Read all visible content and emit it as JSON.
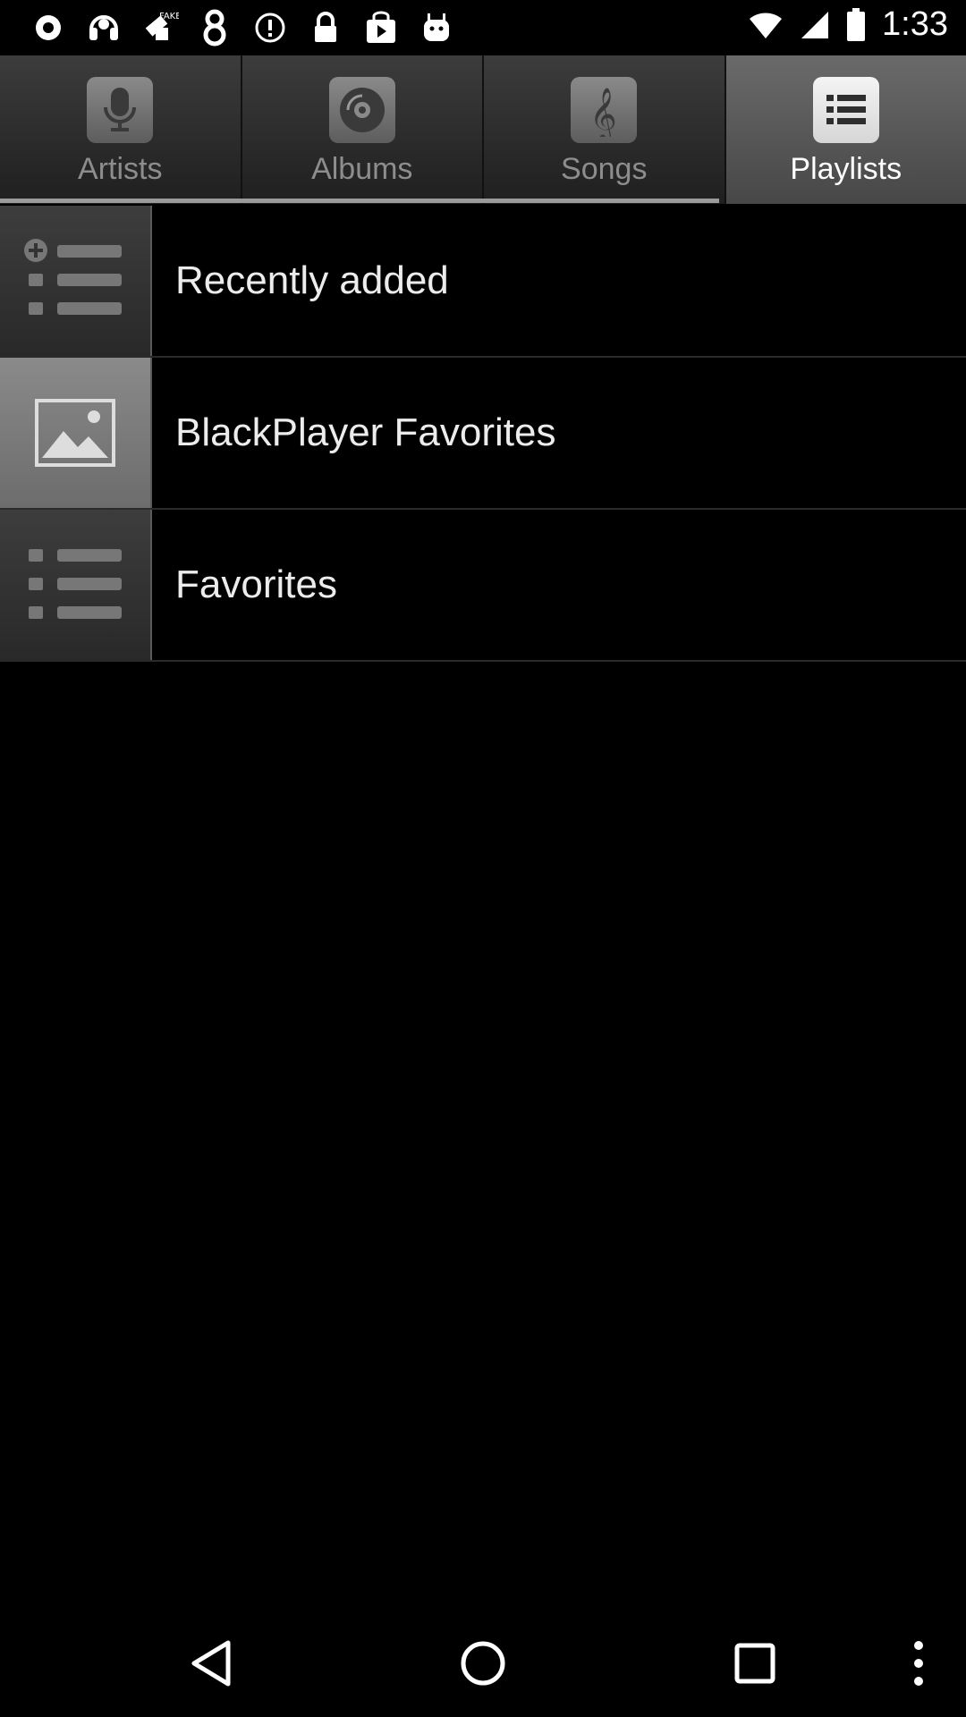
{
  "status_bar": {
    "time": "1:33",
    "icons": [
      "record-icon",
      "headset-icon",
      "fake-gps-icon",
      "eight-icon",
      "info-circle-icon",
      "lock-icon",
      "play-store-icon",
      "android-icon"
    ]
  },
  "tabs": [
    {
      "label": "Artists",
      "icon": "microphone-icon",
      "active": false
    },
    {
      "label": "Albums",
      "icon": "disc-icon",
      "active": false
    },
    {
      "label": "Songs",
      "icon": "treble-clef-icon",
      "active": false
    },
    {
      "label": "Playlists",
      "icon": "list-icon",
      "active": true
    }
  ],
  "playlists": [
    {
      "title": "Recently added",
      "icon": "add-list-icon"
    },
    {
      "title": "BlackPlayer Favorites",
      "icon": "image-icon"
    },
    {
      "title": "Favorites",
      "icon": "list-icon"
    }
  ],
  "colors": {
    "background": "#000000",
    "active_tab": "#5a5a5a",
    "text": "#ececec",
    "inactive_tab_text": "#8d8d8d"
  }
}
